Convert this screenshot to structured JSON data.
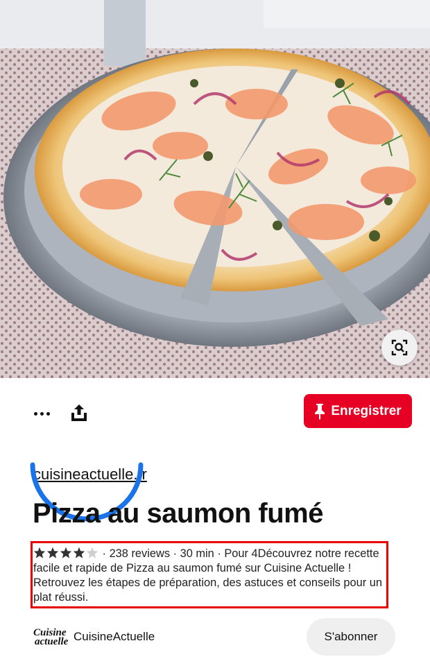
{
  "pin": {
    "image_alt": "Pizza au saumon fumé",
    "source_domain": "cuisineactuelle.fr",
    "title": "Pizza au saumon fumé",
    "rating": 4,
    "rating_max": 5,
    "description": " · 238 reviews · 30 min · Pour 4Découvrez notre recette facile et rapide de Pizza au saumon fumé sur Cuisine Actuelle ! Retrouvez les étapes de préparation, des astuces et conseils pour un plat réussi."
  },
  "actions": {
    "more_icon": "more-horizontal-icon",
    "share_icon": "share-upload-icon",
    "save_label": "Enregistrer",
    "save_icon": "pin-icon",
    "lens_icon": "visual-search-icon"
  },
  "creator": {
    "logo_line1": "Cuisine",
    "logo_line2": "actuelle",
    "name": "CuisineActuelle",
    "follow_label": "S'abonner"
  },
  "colors": {
    "brand_red": "#e60023",
    "annotation_blue": "#1a73e8",
    "annotation_red": "#e60000"
  }
}
